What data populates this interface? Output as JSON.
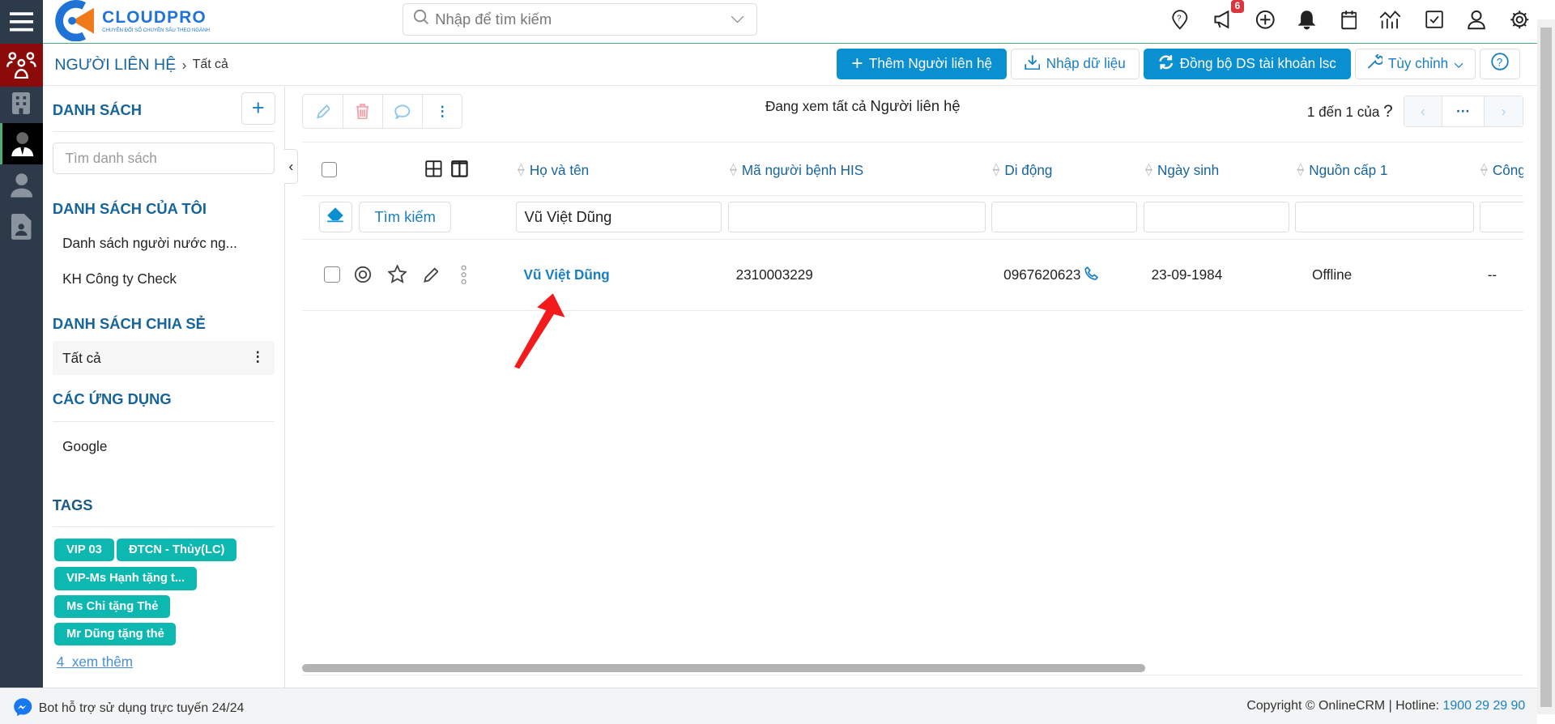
{
  "header": {
    "logo_text": "CLOUDPRO",
    "logo_tagline": "CHUYỂN ĐỔI SỐ CHUYÊN SÂU THEO NGÀNH",
    "search_placeholder": "Nhập để tìm kiếm",
    "notification_count": "6",
    "icons": [
      "map-pin-question-icon",
      "megaphone-icon",
      "plus-circle-icon",
      "bell-icon",
      "calendar-icon",
      "chart-icon",
      "checkbox-icon",
      "user-icon",
      "gear-icon"
    ]
  },
  "rail": {
    "items": [
      "contacts-icon",
      "building-icon",
      "contact-tie-icon",
      "person-icon",
      "contact-card-icon"
    ],
    "active_color": "#8b0a0a"
  },
  "breadcrumb": {
    "module": "NGƯỜI LIÊN HỆ",
    "current": "Tất cả"
  },
  "actions": {
    "add": "Thêm Người liên hệ",
    "import": "Nhập dữ liệu",
    "sync": "Đồng bộ DS tài khoản lsc",
    "customize": "Tùy chỉnh"
  },
  "left_panel": {
    "title": "DANH SÁCH",
    "search_placeholder": "Tìm danh sách",
    "my_lists_title": "DANH SÁCH CỦA TÔI",
    "my_lists": [
      "Danh sách người nước ng...",
      "KH Công ty Check"
    ],
    "shared_title": "DANH SÁCH CHIA SẺ",
    "shared": [
      "Tất cả"
    ],
    "apps_title": "CÁC ỨNG DỤNG",
    "apps": [
      "Google"
    ],
    "tags_title": "TAGS",
    "tags": [
      "VIP 03",
      "ĐTCN - Thủy(LC)",
      "VIP-Ms Hạnh tặng t...",
      "Ms Chi tặng Thẻ",
      "Mr Dũng tặng thẻ"
    ],
    "more_tags": "4  xem thêm",
    "tag_color": "#0cb8b0"
  },
  "main": {
    "viewing_prefix": "Đang xem tất cả",
    "viewing_module": "Người liên hệ",
    "pagination": "1 đến 1 của",
    "pagination_unknown": "?",
    "pagination_more": "···",
    "columns": [
      "Họ và tên",
      "Mã người bệnh HIS",
      "Di động",
      "Ngày sinh",
      "Nguồn cấp 1",
      "Công"
    ],
    "search_button": "Tìm kiếm",
    "filters": {
      "name": "Vũ Việt Dũng"
    },
    "rows": [
      {
        "name": "Vũ Việt Dũng",
        "his_code": "2310003229",
        "mobile": "0967620623",
        "dob": "23-09-1984",
        "source": "Offline",
        "company": "--"
      }
    ]
  },
  "footer": {
    "bot": "Bot hỗ trợ sử dụng trực tuyến 24/24",
    "copyright": "Copyright © OnlineCRM",
    "hotline_label": "Hotline:",
    "hotline": "1900 29 29 90"
  },
  "colors": {
    "primary": "#0a8fd0",
    "heading": "#17649a",
    "rail": "#2c3a4a"
  }
}
